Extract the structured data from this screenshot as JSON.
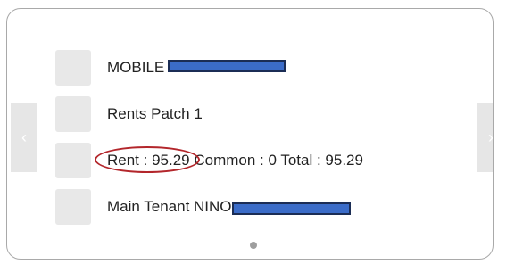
{
  "carousel": {
    "prev_glyph": "‹",
    "next_glyph": "›",
    "items": [
      {
        "label": "MOBILE",
        "icon": "thumbnail-placeholder"
      },
      {
        "label": "Rents Patch 1",
        "icon": "thumbnail-placeholder"
      },
      {
        "rent": "Rent : 95.29",
        "rest": " Common : 0 Total : 95.29",
        "icon": "thumbnail-placeholder"
      },
      {
        "label": "Main Tenant NINO",
        "icon": "thumbnail-placeholder"
      }
    ],
    "page_dots": 1,
    "active_page": 1
  },
  "colors": {
    "redaction_fill": "#3b6cc8",
    "redaction_border": "#1b2d55",
    "annotation_oval": "#b3262b",
    "nav_button": "#e6e6e6",
    "thumb": "#e8e8e8"
  }
}
